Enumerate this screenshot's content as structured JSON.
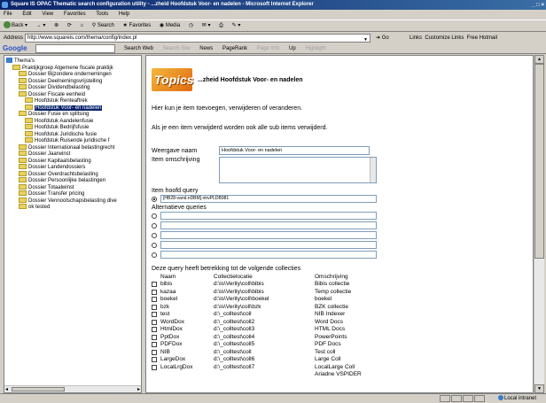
{
  "window": {
    "title": "Square IS OPAC Thematic search configuration utility - ...zheid Hoofdstuk Voor- en nadelen - Microsoft Internet Explorer",
    "controls": "_ □ ×"
  },
  "menu": [
    "File",
    "Edit",
    "View",
    "Favorites",
    "Tools",
    "Help"
  ],
  "toolbar": {
    "back": "Back",
    "search": "Search",
    "favorites": "Favorites",
    "media": "Media"
  },
  "address": {
    "label": "Address",
    "url": "http://www.squareis.com/thema/config/index.pl",
    "go": "Go",
    "links": "Links",
    "link1": "Customize Links",
    "link2": "Free Hotmail"
  },
  "google": {
    "logo": "Google",
    "search_web": "Search Web",
    "search_site": "Search Site",
    "news": "News",
    "pagerank": "PageRank",
    "page_info": "Page Info",
    "up": "Up",
    "highlight": "Highlight"
  },
  "tree": {
    "root": "Thema's",
    "items": [
      {
        "label": "Praktijkgroep Algemene fiscale praktijk",
        "level": 1
      },
      {
        "label": "Dossier Bijzondere ondernemingen",
        "level": 2
      },
      {
        "label": "Dossier Deelnemingsvrijstelling",
        "level": 2
      },
      {
        "label": "Dossier Dividendbelasting",
        "level": 2
      },
      {
        "label": "Dossier Fiscale eenheid",
        "level": 2
      },
      {
        "label": "Hoofdstuk Renteaftrek",
        "level": 3
      },
      {
        "label": "Hoofdstuk Voor- en nadelen",
        "level": 3,
        "selected": true
      },
      {
        "label": "Dossier Fusie en splitsing",
        "level": 2
      },
      {
        "label": "Hoofdstuk Aandelenfusie",
        "level": 3
      },
      {
        "label": "Hoofdstuk Bedrijfsfusie",
        "level": 3
      },
      {
        "label": "Hoofdstuk Juridische fusie",
        "level": 3
      },
      {
        "label": "Hoofdstuk Ruisende juridische f",
        "level": 3
      },
      {
        "label": "Dossier Internationaal belastingrecht",
        "level": 2
      },
      {
        "label": "Dossier Jaarwinst",
        "level": 2
      },
      {
        "label": "Dossier Kapitaalsbelasting",
        "level": 2
      },
      {
        "label": "Dossier Landendossiers",
        "level": 2
      },
      {
        "label": "Dossier Overdrachtsbelasting",
        "level": 2
      },
      {
        "label": "Dossier Persoonlijke belastingen",
        "level": 2
      },
      {
        "label": "Dossier Totaalwinst",
        "level": 2
      },
      {
        "label": "Dossier Transfer pricing",
        "level": 2
      },
      {
        "label": "Dossier Vennootschapsbelasting dive",
        "level": 2
      },
      {
        "label": "ok tested",
        "level": 2
      }
    ]
  },
  "page": {
    "logo": "Topics",
    "title": "...zheid Hoofdstuk Voor- en nadelen",
    "intro": "Hier kun je item toevoegen, verwijderen of veranderen.",
    "warning": "Als je een item verwijderd worden ook alle sub items verwijderd.",
    "name_label": "Weergave naam",
    "name_value": "Hoofdstuk Voor- en nadelen",
    "desc_label": "Item omschrijving",
    "main_query_label": "Item hoofd query",
    "main_query_value": "[HB28-vand.nDBM].ntrvPLDB981",
    "alt_label": "Alternatieve queries",
    "alt_values": [
      "",
      "",
      "",
      "",
      ""
    ],
    "coll_label": "Deze query heeft betrekking tot de volgende collecties",
    "coll_headers": [
      "Naam",
      "Collectielocatie",
      "Omschrijving"
    ],
    "collections": [
      [
        "bibis",
        "d:\\is\\Verity\\coll\\bibis",
        "Bibis collectie"
      ],
      [
        "kazaa",
        "d:\\is\\Verity\\coll\\bibis",
        "Temp collectie"
      ],
      [
        "boekel",
        "d:\\is\\Verity\\coll\\boekel",
        "boekel"
      ],
      [
        "bzk",
        "d:\\is\\Verity\\coll\\bzk",
        "BZK collectie"
      ],
      [
        "test",
        "d:\\_colltest\\coll",
        "NIB Indexer"
      ],
      [
        "WordDox",
        "d:\\_colltest\\coll2",
        "Word Docs"
      ],
      [
        "HtmlDox",
        "d:\\_colltest\\coll3",
        "HTML Docs"
      ],
      [
        "PptDox",
        "d:\\_colltest\\coll4",
        "PowerPoints"
      ],
      [
        "PDFDox",
        "d:\\_colltest\\coll5",
        "PDF Docs"
      ],
      [
        "NIB",
        "d:\\_colltest\\coll",
        "Test coll"
      ],
      [
        "LargeDox",
        "d:\\_colltest\\coll6",
        "Large Coll"
      ],
      [
        "LocalLrgDox",
        "d:\\_colltest\\coll7",
        "LocalLarge Coll"
      ],
      [
        "",
        "",
        "Ariadne VSPIDER"
      ]
    ]
  },
  "status": {
    "zone": "Local intranet"
  }
}
